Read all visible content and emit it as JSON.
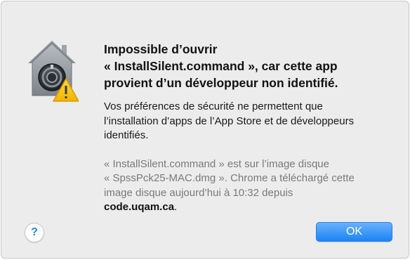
{
  "dialog": {
    "title_lines": [
      "Impossible d’ouvrir",
      "« InstallSilent.command », car cette app",
      "provient d’un développeur non identifié."
    ],
    "message_lines": [
      "Vos préférences de sécurité ne permettent que",
      "l’installation d’apps de l’App Store et de développeurs",
      "identifiés."
    ],
    "info_lines": [
      "« InstallSilent.command » est sur l’image disque",
      "« SpssPck25-MAC.dmg ». Chrome a téléchargé cette",
      "image disque aujourd’hui à 10:32 depuis"
    ],
    "info_host": "code.uqam.ca",
    "info_host_suffix": ".",
    "icon": "gatekeeper-lock-house-icon",
    "warning_icon": "warning-triangle-icon"
  },
  "buttons": {
    "help_label": "?",
    "ok_label": "OK"
  },
  "colors": {
    "dialog_background": "#ececec",
    "accent": "#1b84f5",
    "secondary_text": "#7a7a7a",
    "warning": "#f5c400"
  }
}
